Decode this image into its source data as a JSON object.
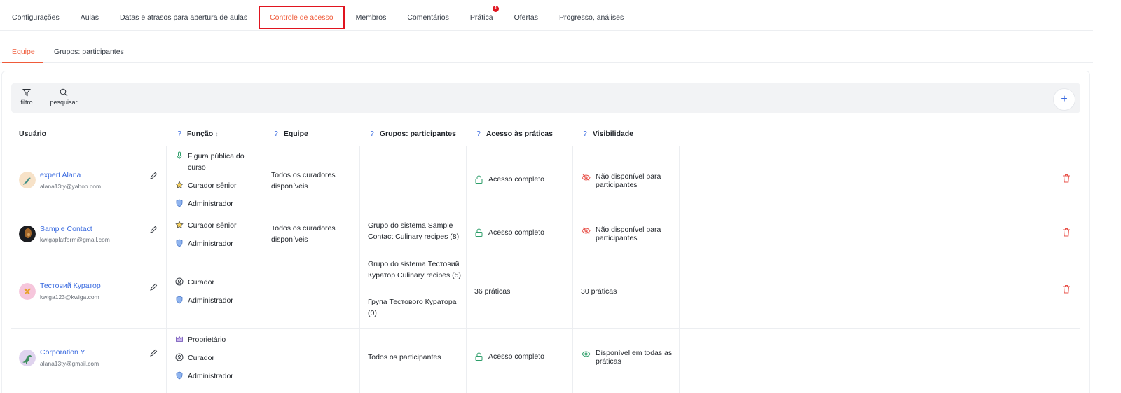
{
  "main_tabs": [
    {
      "label": "Configurações"
    },
    {
      "label": "Aulas"
    },
    {
      "label": "Datas e atrasos para abertura de aulas"
    },
    {
      "label": "Controle de acesso"
    },
    {
      "label": "Membros"
    },
    {
      "label": "Comentários"
    },
    {
      "label": "Prática",
      "badge": "4"
    },
    {
      "label": "Ofertas"
    },
    {
      "label": "Progresso, análises"
    }
  ],
  "sub_tabs": [
    {
      "label": "Equipe"
    },
    {
      "label": "Grupos: participantes"
    }
  ],
  "toolbar": {
    "filter_label": "filtro",
    "search_label": "pesquisar",
    "add_label": "+"
  },
  "columns": {
    "user": "Usuário",
    "role": "Função",
    "team": "Equipe",
    "groups": "Grupos: participantes",
    "access": "Acesso às práticas",
    "visibility": "Visibilidade",
    "help": "?",
    "sort": "↕"
  },
  "rows": [
    {
      "name": "expert Alana",
      "email": "alana13ty@yahoo.com",
      "roles": [
        "Figura pública do curso",
        "Curador sênior",
        "Administrador"
      ],
      "team": "Todos os curadores disponíveis",
      "groups": [],
      "access": "Acesso completo",
      "visibility": "Não disponível para participantes"
    },
    {
      "name": "Sample Contact",
      "email": "kwigaplatform@gmail.com",
      "roles": [
        "Curador sênior",
        "Administrador"
      ],
      "team": "Todos os curadores disponíveis",
      "groups": [
        "Grupo do sistema Sample Contact Culinary recipes (8)"
      ],
      "access": "Acesso completo",
      "visibility": "Não disponível para participantes"
    },
    {
      "name": "Тестовий Куратор",
      "email": "kwiga123@kwiga.com",
      "roles": [
        "Curador",
        "Administrador"
      ],
      "team": "",
      "groups": [
        "Grupo do sistema Тестовий Куратор Culinary recipes (5)",
        "Група Тестового Куратора (0)"
      ],
      "access": "36 práticas",
      "visibility": "30 práticas"
    },
    {
      "name": "Corporation Y",
      "email": "alana13ty@gmail.com",
      "roles": [
        "Proprietário",
        "Curador",
        "Administrador"
      ],
      "team": "",
      "groups": [
        "Todos os participantes"
      ],
      "access": "Acesso completo",
      "visibility": "Disponível em todas as práticas"
    }
  ],
  "colors": {
    "accent": "#ef5b3a",
    "link": "#3a6be0",
    "highlight_border": "#e0141f",
    "danger": "#e8524a",
    "visible_green": "#2e9e6a"
  }
}
